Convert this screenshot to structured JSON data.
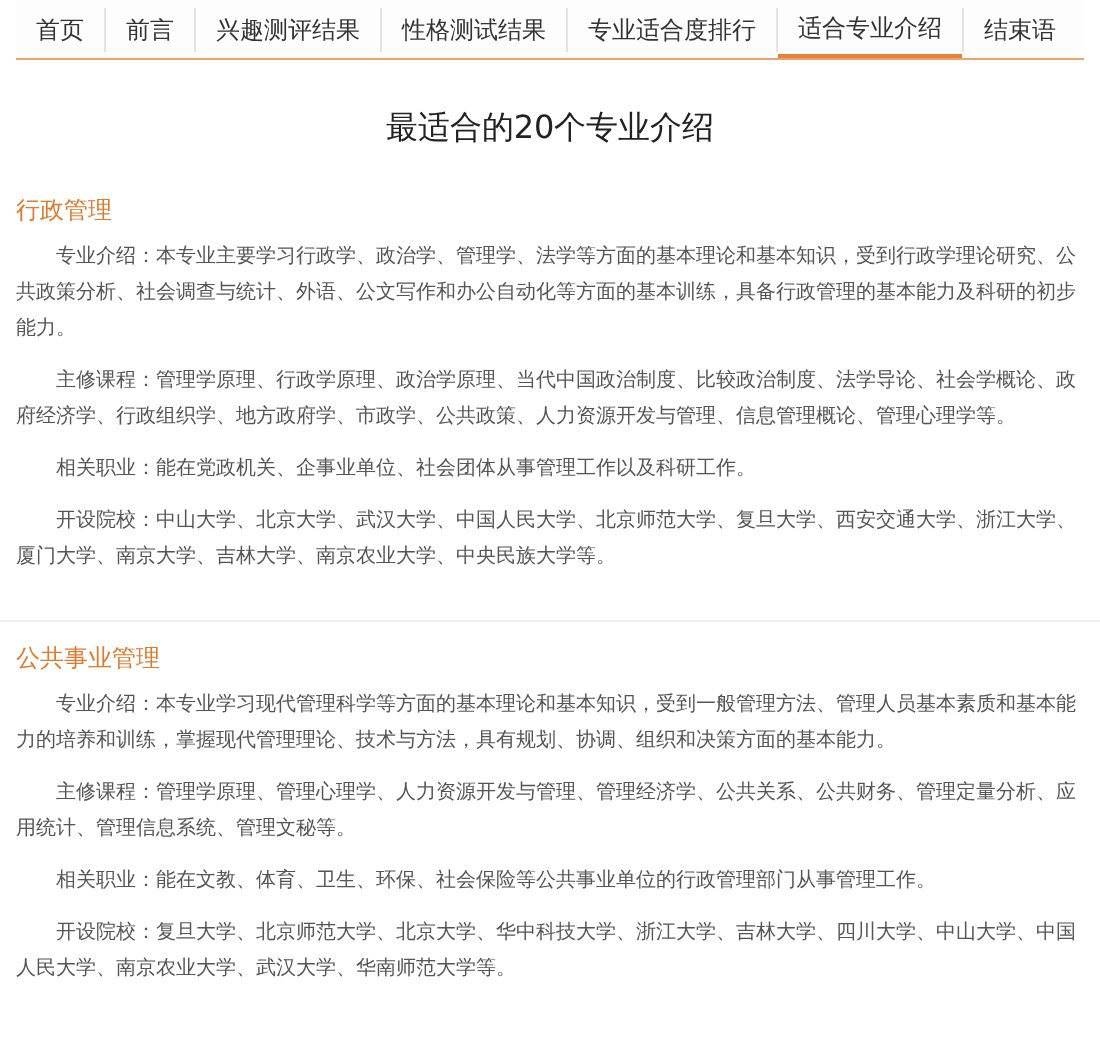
{
  "tabs": [
    {
      "label": "首页",
      "selected": false
    },
    {
      "label": "前言",
      "selected": false
    },
    {
      "label": "兴趣测评结果",
      "selected": false
    },
    {
      "label": "性格测试结果",
      "selected": false
    },
    {
      "label": "专业适合度排行",
      "selected": false
    },
    {
      "label": "适合专业介绍",
      "selected": true
    },
    {
      "label": "结束语",
      "selected": false
    }
  ],
  "title": "最适合的20个专业介绍",
  "majors": [
    {
      "name": "行政管理",
      "paragraphs": [
        "专业介绍：本专业主要学习行政学、政治学、管理学、法学等方面的基本理论和基本知识，受到行政学理论研究、公共政策分析、社会调查与统计、外语、公文写作和办公自动化等方面的基本训练，具备行政管理的基本能力及科研的初步能力。",
        "主修课程：管理学原理、行政学原理、政治学原理、当代中国政治制度、比较政治制度、法学导论、社会学概论、政府经济学、行政组织学、地方政府学、市政学、公共政策、人力资源开发与管理、信息管理概论、管理心理学等。",
        "相关职业：能在党政机关、企事业单位、社会团体从事管理工作以及科研工作。",
        "开设院校：中山大学、北京大学、武汉大学、中国人民大学、北京师范大学、复旦大学、西安交通大学、浙江大学、厦门大学、南京大学、吉林大学、南京农业大学、中央民族大学等。"
      ]
    },
    {
      "name": "公共事业管理",
      "paragraphs": [
        "专业介绍：本专业学习现代管理科学等方面的基本理论和基本知识，受到一般管理方法、管理人员基本素质和基本能力的培养和训练，掌握现代管理理论、技术与方法，具有规划、协调、组织和决策方面的基本能力。",
        "主修课程：管理学原理、管理心理学、人力资源开发与管理、管理经济学、公共关系、公共财务、管理定量分析、应用统计、管理信息系统、管理文秘等。",
        "相关职业：能在文教、体育、卫生、环保、社会保险等公共事业单位的行政管理部门从事管理工作。",
        "开设院校：复旦大学、北京师范大学、北京大学、华中科技大学、浙江大学、吉林大学、四川大学、中山大学、中国人民大学、南京农业大学、武汉大学、华南师范大学等。"
      ]
    }
  ]
}
